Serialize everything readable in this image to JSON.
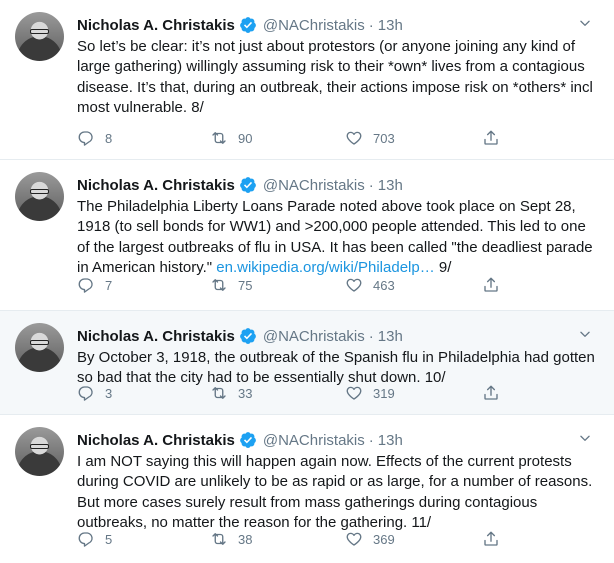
{
  "colors": {
    "text": "#14171a",
    "muted": "#657786",
    "link": "#1b95e0",
    "verified": "#1da1f2",
    "highlight_bg": "#f5f8fa",
    "divider": "#e6ecf0"
  },
  "icons": {
    "verified": "verified-badge-icon",
    "reply": "reply-icon",
    "retweet": "retweet-icon",
    "like": "heart-icon",
    "share": "share-icon",
    "more": "chevron-down-icon"
  },
  "tweets": [
    {
      "name": "Nicholas A. Christakis",
      "handle": "@NAChristakis",
      "separator": "·",
      "time": "13h",
      "text": "So let’s be clear: it’s not just about protestors (or anyone joining any kind of large gathering) willingly assuming risk to their *own* lives from a contagious disease. It’s that, during an outbreak, their actions impose risk on *others* incl most vulnerable. 8/",
      "link": "",
      "after_link": "",
      "replies": "8",
      "retweets": "90",
      "likes": "703"
    },
    {
      "name": "Nicholas A. Christakis",
      "handle": "@NAChristakis",
      "separator": "·",
      "time": "13h",
      "text": "The Philadelphia Liberty Loans Parade noted above took place on Sept 28, 1918 (to sell bonds for WW1) and >200,000 people attended. This led to one of the largest outbreaks of flu in USA. It has been called \"the deadliest parade in American history.\" ",
      "link": "en.wikipedia.org/wiki/Philadelp…",
      "after_link": " 9/",
      "replies": "7",
      "retweets": "75",
      "likes": "463"
    },
    {
      "name": "Nicholas A. Christakis",
      "handle": "@NAChristakis",
      "separator": "·",
      "time": "13h",
      "text": "By October 3, 1918, the outbreak of the Spanish flu in Philadelphia had gotten so bad that the city had to be essentially shut down. 10/",
      "link": "",
      "after_link": "",
      "replies": "3",
      "retweets": "33",
      "likes": "319"
    },
    {
      "name": "Nicholas A. Christakis",
      "handle": "@NAChristakis",
      "separator": "·",
      "time": "13h",
      "text": "I am NOT saying this will happen again now. Effects of the current protests during COVID are unlikely to be as rapid or as large, for a number of reasons. But more cases surely result from mass gatherings during contagious outbreaks, no matter the reason for the gathering. 11/",
      "link": "",
      "after_link": "",
      "replies": "5",
      "retweets": "38",
      "likes": "369"
    }
  ]
}
